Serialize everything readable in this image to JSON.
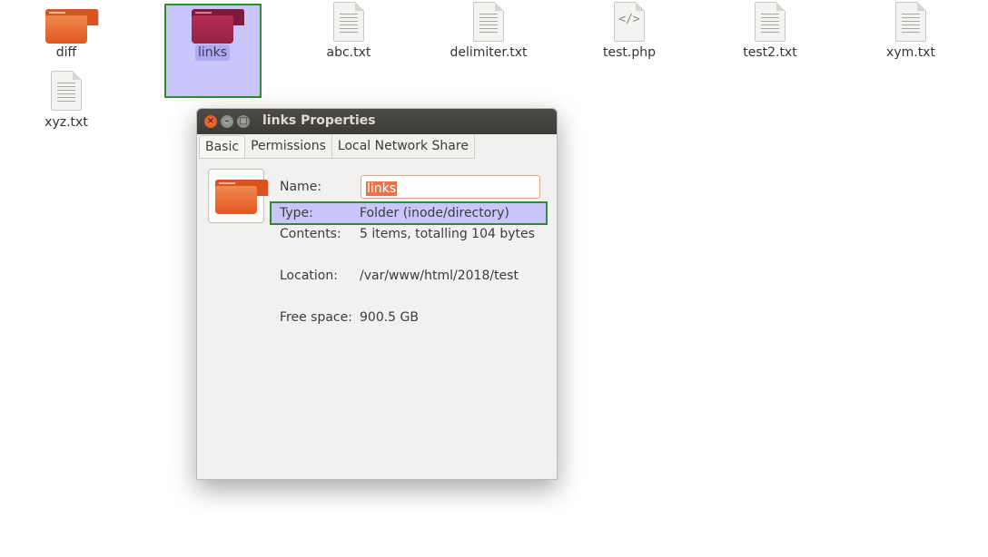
{
  "desktop": {
    "files": [
      {
        "label": "diff",
        "kind": "folder"
      },
      {
        "label": "links",
        "kind": "folder-selected"
      },
      {
        "label": "abc.txt",
        "kind": "text"
      },
      {
        "label": "delimiter.txt",
        "kind": "text"
      },
      {
        "label": "test.php",
        "kind": "code"
      },
      {
        "label": "test2.txt",
        "kind": "text"
      },
      {
        "label": "xym.txt",
        "kind": "text"
      },
      {
        "label": "xyz.txt",
        "kind": "text"
      }
    ],
    "code_glyph": "</>"
  },
  "window": {
    "title": "links Properties",
    "buttons": {
      "close": "×",
      "minimize": "–",
      "maximize": "□"
    },
    "tabs": [
      "Basic",
      "Permissions",
      "Local Network Share"
    ],
    "active_tab": "Basic",
    "fields": {
      "name_label": "Name:",
      "name_value": "links",
      "type_label": "Type:",
      "type_value": "Folder (inode/directory)",
      "contents_label": "Contents:",
      "contents_value": "5 items, totalling 104 bytes",
      "location_label": "Location:",
      "location_value": "/var/www/html/2018/test",
      "free_label": "Free space:",
      "free_value": "900.5 GB"
    }
  },
  "colors": {
    "folder_orange": "#e8692f",
    "folder_selected": "#a0244a",
    "selection": "#c8c6fa",
    "highlight_border": "#2e8b2e",
    "titlebar": "#3c3b37"
  }
}
